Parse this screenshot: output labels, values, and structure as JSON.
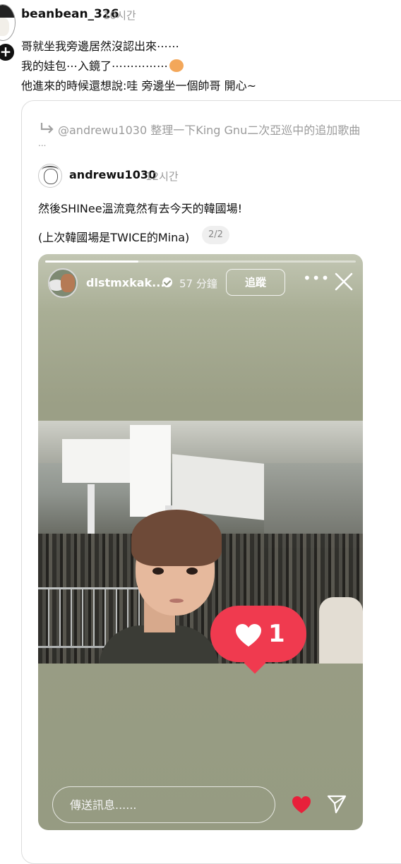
{
  "post": {
    "username": "beanbean_326",
    "time": "10시간",
    "lines": [
      "哥就坐我旁邊居然沒認出來⋯⋯",
      "我的娃包⋯入鏡了⋯⋯⋯⋯⋯",
      "他進來的時候還想說:哇 旁邊坐一個帥哥 開心~"
    ]
  },
  "quote": {
    "reply_to": "@andrewu1030 整理一下King Gnu二次亞巡中的追加歌曲",
    "reply_more": "...",
    "username": "andrewu1030",
    "time": "12시간",
    "line1": "然後SHINee溫流竟然有去今天的韓國場!",
    "line2": "(上次韓國場是TWICE的Mina)",
    "page_indicator": "2/2"
  },
  "story": {
    "progress": 0.3,
    "username": "dlstmxkak...",
    "time": "57 分鐘",
    "follow_label": "追蹤",
    "more": "•••",
    "like_count": "1",
    "message_placeholder": "傳送訊息......",
    "colors": {
      "like": "#f03a4f",
      "heart_button": "#e8203a"
    }
  },
  "icons": {
    "plus": "plus-icon",
    "reply": "reply-arrow-icon",
    "verified": "verified-check-icon",
    "close": "close-icon",
    "heart": "heart-icon",
    "send": "send-icon"
  }
}
